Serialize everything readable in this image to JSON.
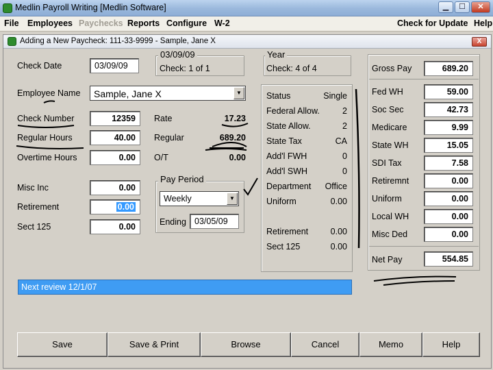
{
  "window": {
    "title": "Medlin Payroll Writing [Medlin Software]",
    "controls": [
      "minimize-icon",
      "maximize-icon",
      "close-icon"
    ]
  },
  "menu": {
    "items": [
      "File",
      "Employees",
      "Paychecks",
      "Reports",
      "Configure",
      "W-2"
    ],
    "right": [
      "Check for Update",
      "Help"
    ]
  },
  "dialog": {
    "title": "Adding a New Paycheck: 111-33-9999 - Sample, Jane X",
    "close": "X"
  },
  "check_date": {
    "label": "Check Date",
    "value": "03/09/09"
  },
  "check_box": {
    "date": "03/09/09",
    "check_of": "Check: 1 of 1"
  },
  "year_box": {
    "title": "Year",
    "check_of": "Check: 4 of 4"
  },
  "employee": {
    "label": "Employee Name",
    "value": "Sample, Jane X"
  },
  "left_fields": [
    {
      "label": "Check Number",
      "value": "12359"
    },
    {
      "label": "Regular Hours",
      "value": "40.00"
    },
    {
      "label": "Overtime Hours",
      "value": "0.00"
    }
  ],
  "rates": [
    {
      "label": "Rate",
      "value": "17.23"
    },
    {
      "label": "Regular",
      "value": "689.20"
    },
    {
      "label": "O/T",
      "value": "0.00"
    }
  ],
  "misc_fields": [
    {
      "label": "Misc Inc",
      "value": "0.00"
    },
    {
      "label": "Retirement",
      "value": "0.00"
    },
    {
      "label": "Sect 125",
      "value": "0.00"
    }
  ],
  "pay_period": {
    "title": "Pay Period",
    "selected": "Weekly",
    "ending_label": "Ending",
    "ending_value": "03/05/09"
  },
  "info": [
    {
      "label": "Status",
      "value": "Single"
    },
    {
      "label": "Federal Allow.",
      "value": "2"
    },
    {
      "label": "State Allow.",
      "value": "2"
    },
    {
      "label": "State Tax",
      "value": "CA"
    },
    {
      "label": "Add'l FWH",
      "value": "0"
    },
    {
      "label": "Add'l SWH",
      "value": "0"
    },
    {
      "label": "Department",
      "value": "Office"
    },
    {
      "label": "Uniform",
      "value": "0.00"
    },
    {
      "label": "Retirement",
      "value": "0.00"
    },
    {
      "label": "Sect 125",
      "value": "0.00"
    }
  ],
  "gross": {
    "label": "Gross Pay",
    "value": "689.20"
  },
  "deductions": [
    {
      "label": "Fed WH",
      "value": "59.00"
    },
    {
      "label": "Soc Sec",
      "value": "42.73"
    },
    {
      "label": "Medicare",
      "value": "9.99"
    },
    {
      "label": "State WH",
      "value": "15.05"
    },
    {
      "label": "SDI Tax",
      "value": "7.58"
    },
    {
      "label": "Retiremnt",
      "value": "0.00"
    },
    {
      "label": "Uniform",
      "value": "0.00"
    },
    {
      "label": "Local WH",
      "value": "0.00"
    },
    {
      "label": "Misc Ded",
      "value": "0.00"
    }
  ],
  "net": {
    "label": "Net Pay",
    "value": "554.85"
  },
  "notes": "Next review 12/1/07",
  "buttons": [
    "Save",
    "Save & Print",
    "Browse",
    "Cancel",
    "Memo",
    "Help"
  ],
  "colors": {
    "selection": "#3f9cf3",
    "face": "#d4d0c8",
    "titlebar": "#9ab8dc"
  }
}
